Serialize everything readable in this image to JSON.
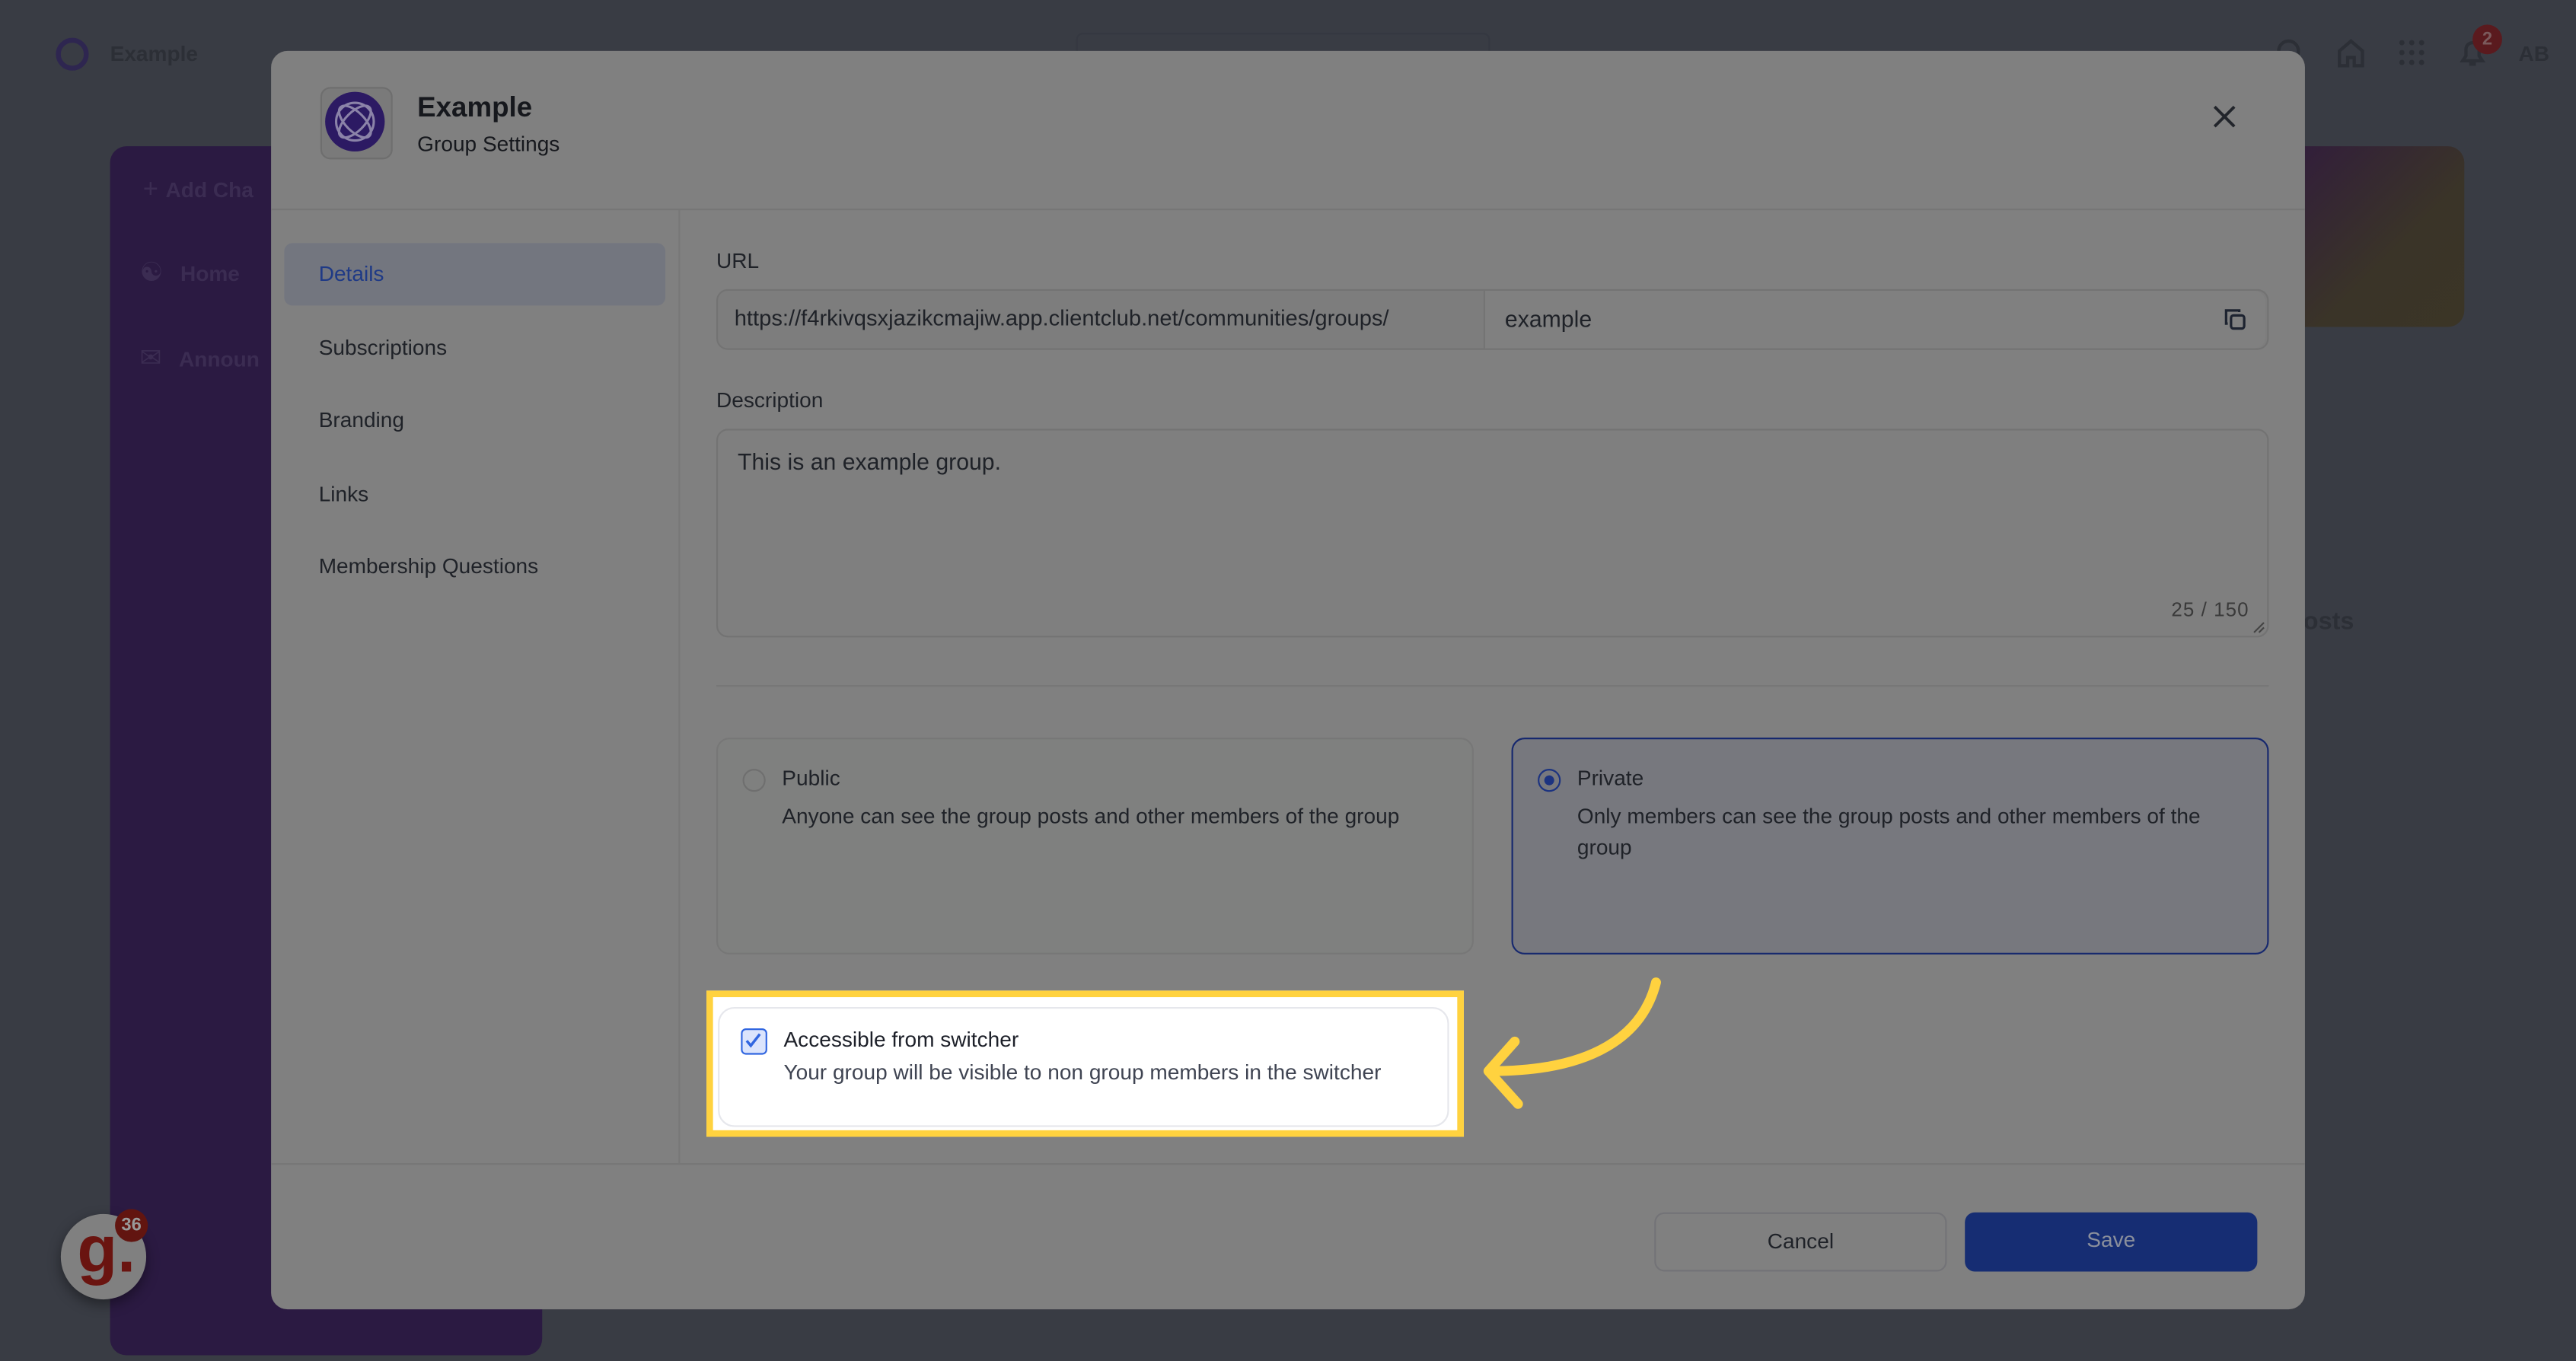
{
  "app": {
    "name": "Example",
    "badge_count": "2",
    "avatar_initials": "AB"
  },
  "background": {
    "sidebar_items": [
      {
        "label": "Add Cha",
        "icon": "plus-icon"
      },
      {
        "label": "Home",
        "icon": "users-icon"
      },
      {
        "label": "Announ",
        "icon": "megaphone-icon"
      }
    ],
    "posts_label": "Posts"
  },
  "modal": {
    "title": "Example",
    "subtitle": "Group Settings",
    "nav": [
      {
        "label": "Details",
        "active": true
      },
      {
        "label": "Subscriptions"
      },
      {
        "label": "Branding"
      },
      {
        "label": "Links"
      },
      {
        "label": "Membership Questions"
      }
    ],
    "url": {
      "label": "URL",
      "prefix": "https://f4rkivqsxjazikcmajiw.app.clientclub.net/communities/groups/",
      "slug": "example"
    },
    "description": {
      "label": "Description",
      "value": "This is an example group.",
      "counter": "25 / 150"
    },
    "privacy": {
      "selected": "private",
      "options": [
        {
          "id": "public",
          "title": "Public",
          "desc": "Anyone can see the group posts and other members of the group"
        },
        {
          "id": "private",
          "title": "Private",
          "desc": "Only members can see the group posts and other members of the group"
        }
      ]
    },
    "switcher": {
      "checked": true,
      "title": "Accessible from switcher",
      "desc": "Your group will be visible to non group members in the switcher"
    },
    "cancel_label": "Cancel",
    "save_label": "Save"
  },
  "widget": {
    "letter": "g.",
    "badge": "36"
  },
  "colors": {
    "accent": "#1f3a86",
    "highlight": "#ffd23f",
    "save_bg": "#162d73"
  }
}
